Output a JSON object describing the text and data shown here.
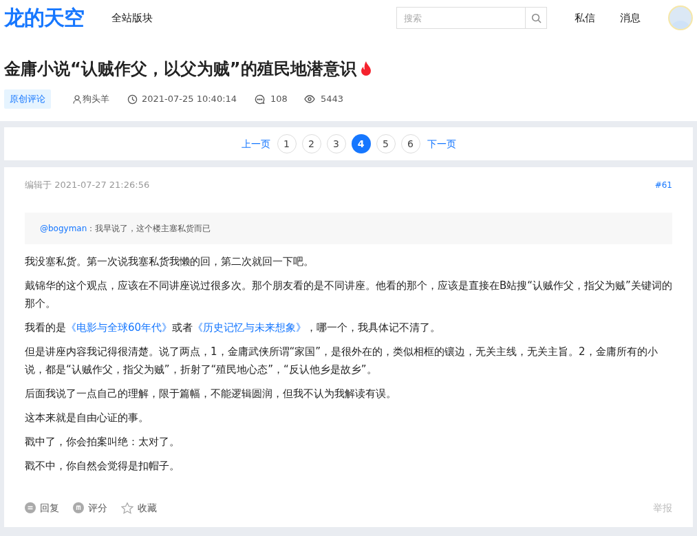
{
  "header": {
    "logo": "龙的天空",
    "nav": "全站版块",
    "search": {
      "placeholder": "搜索"
    },
    "links": [
      "私信",
      "消息"
    ]
  },
  "thread": {
    "title": "金庸小说“认贼作父，以父为贼”的殖民地潜意识",
    "hot": true,
    "tag": "原创评论",
    "author": "狗头羊",
    "time": "2021-07-25 10:40:14",
    "replies": "108",
    "views": "5443"
  },
  "pagination": {
    "prev": "上一页",
    "next": "下一页",
    "pages": [
      {
        "label": "1",
        "selected": false
      },
      {
        "label": "2",
        "selected": false
      },
      {
        "label": "3",
        "selected": false
      },
      {
        "label": "4",
        "selected": true
      },
      {
        "label": "5",
        "selected": false
      },
      {
        "label": "6",
        "selected": false
      }
    ]
  },
  "post": {
    "edited": "编辑于 2021-07-27 21:26:56",
    "floor": "#61",
    "quote": {
      "user": "@bogyman",
      "text": "：我早说了，这个楼主塞私货而已"
    },
    "paragraphs": [
      [
        {
          "kind": "text",
          "text": "我没塞私货。第一次说我塞私货我懒的回，第二次就回一下吧。"
        }
      ],
      [
        {
          "kind": "text",
          "text": "戴锦华的这个观点，应该在不同讲座说过很多次。那个朋友看的是不同讲座。他看的那个，应该是直接在B站搜“认贼作父，指父为贼”关键词的那个。"
        }
      ],
      [
        {
          "kind": "text",
          "text": "我看的是"
        },
        {
          "kind": "link",
          "text": "《电影与全球60年代》"
        },
        {
          "kind": "text",
          "text": "或者"
        },
        {
          "kind": "link",
          "text": "《历史记忆与未来想象》"
        },
        {
          "kind": "text",
          "text": "，哪一个，我具体记不清了。"
        }
      ],
      [
        {
          "kind": "text",
          "text": "但是讲座内容我记得很清楚。说了两点，1，金庸武侠所谓“家国”，是很外在的，类似相框的镶边，无关主线，无关主旨。2，金庸所有的小说，都是“认贼作父，指父为贼”，折射了“殖民地心态”，“反认他乡是故乡”。"
        }
      ],
      [
        {
          "kind": "text",
          "text": "后面我说了一点自己的理解，限于篇幅，不能逻辑圆润，但我不认为我解读有误。"
        }
      ],
      [
        {
          "kind": "text",
          "text": "这本来就是自由心证的事。"
        }
      ],
      [
        {
          "kind": "text",
          "text": "戳中了，你会拍案叫绝：太对了。"
        }
      ],
      [
        {
          "kind": "text",
          "text": "戳不中，你自然会觉得是扣帽子。"
        }
      ]
    ],
    "actions": [
      {
        "kind": "reply",
        "label": "回复"
      },
      {
        "kind": "rate",
        "label": "评分"
      },
      {
        "kind": "favorite",
        "label": "收藏"
      }
    ],
    "report": "举报"
  }
}
